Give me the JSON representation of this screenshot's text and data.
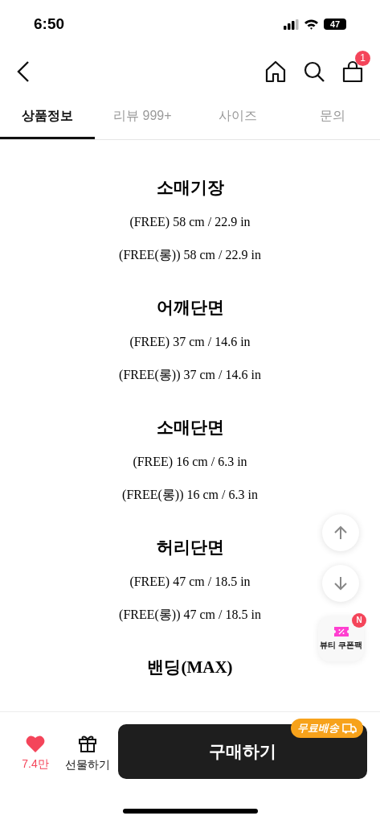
{
  "status_bar": {
    "time": "6:50",
    "battery": "47"
  },
  "nav": {
    "cart_badge": "1"
  },
  "tabs": [
    {
      "label": "상품정보",
      "selected": true
    },
    {
      "label": "리뷰 999+",
      "selected": false
    },
    {
      "label": "사이즈",
      "selected": false
    },
    {
      "label": "문의",
      "selected": false
    }
  ],
  "sections": [
    {
      "heading": "소매기장",
      "lines": [
        "(FREE) 58 cm / 22.9 in",
        "(FREE(롱)) 58 cm / 22.9 in"
      ]
    },
    {
      "heading": "어깨단면",
      "lines": [
        "(FREE) 37 cm / 14.6 in",
        "(FREE(롱)) 37 cm / 14.6 in"
      ]
    },
    {
      "heading": "소매단면",
      "lines": [
        "(FREE) 16 cm / 6.3 in",
        "(FREE(롱)) 16 cm / 6.3 in"
      ]
    },
    {
      "heading": "허리단면",
      "lines": [
        "(FREE) 47 cm / 18.5 in",
        "(FREE(롱)) 47 cm / 18.5 in"
      ]
    },
    {
      "heading": "밴딩(MAX)"
    }
  ],
  "coupon": {
    "label": "뷰티 쿠폰팩",
    "badge": "N"
  },
  "bottom_bar": {
    "like_count": "7.4만",
    "gift_label": "선물하기",
    "buy_label": "구매하기",
    "shipping_badge": "무료배송"
  }
}
